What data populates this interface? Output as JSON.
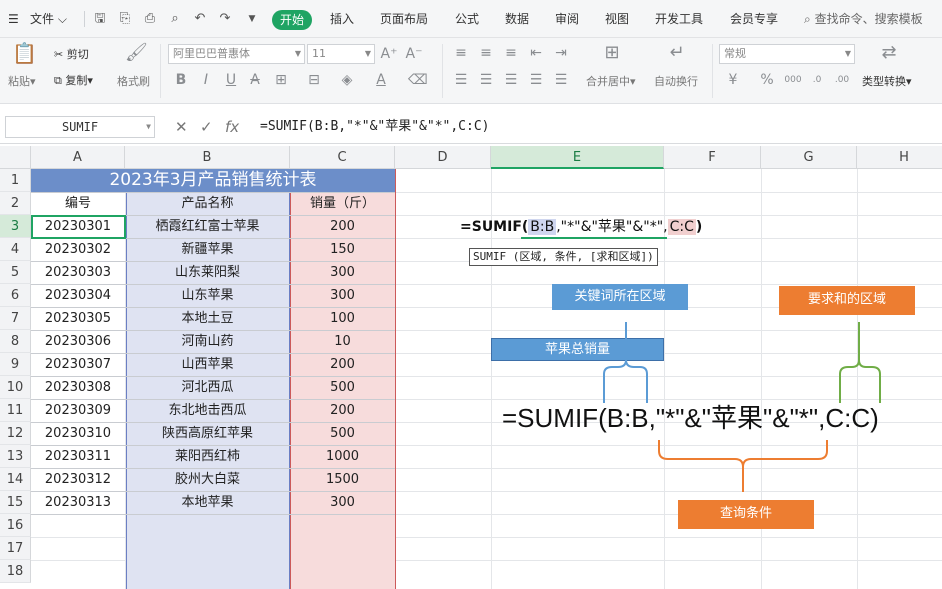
{
  "menu": {
    "file": "文件",
    "tabs": [
      "开始",
      "插入",
      "页面布局",
      "公式",
      "数据",
      "审阅",
      "视图",
      "开发工具",
      "会员专享"
    ],
    "search": "查找命令、搜索模板"
  },
  "ribbon": {
    "paste": "粘贴",
    "cut": "剪切",
    "copy": "复制",
    "format_painter": "格式刷",
    "font_name": "阿里巴巴普惠体",
    "font_size": "11",
    "merge": "合并居中",
    "wrap": "自动换行",
    "number_format": "常规",
    "type_convert": "类型转换"
  },
  "formula_bar": {
    "name_box": "SUMIF",
    "formula": "=SUMIF(B:B,\"*\"&\"苹果\"&\"*\",C:C)"
  },
  "columns": [
    "A",
    "B",
    "C",
    "D",
    "E",
    "F",
    "G",
    "H"
  ],
  "rows": [
    "1",
    "2",
    "3",
    "4",
    "5",
    "6",
    "7",
    "8",
    "9",
    "10",
    "11",
    "12",
    "13",
    "14",
    "15",
    "16",
    "17",
    "18"
  ],
  "table": {
    "title": "2023年3月产品销售统计表",
    "headers": [
      "编号",
      "产品名称",
      "销量（斤）"
    ],
    "records": [
      {
        "id": "20230301",
        "name": "栖霞红红富士苹果",
        "qty": "200"
      },
      {
        "id": "20230302",
        "name": "新疆苹果",
        "qty": "150"
      },
      {
        "id": "20230303",
        "name": "山东莱阳梨",
        "qty": "300"
      },
      {
        "id": "20230304",
        "name": "山东苹果",
        "qty": "300"
      },
      {
        "id": "20230305",
        "name": "本地土豆",
        "qty": "100"
      },
      {
        "id": "20230306",
        "name": "河南山药",
        "qty": "10"
      },
      {
        "id": "20230307",
        "name": "山西苹果",
        "qty": "200"
      },
      {
        "id": "20230308",
        "name": "河北西瓜",
        "qty": "500"
      },
      {
        "id": "20230309",
        "name": "东北地击西瓜",
        "qty": "200"
      },
      {
        "id": "20230310",
        "name": "陕西高原红苹果",
        "qty": "500"
      },
      {
        "id": "20230311",
        "name": "莱阳西红柿",
        "qty": "1000"
      },
      {
        "id": "20230312",
        "name": "胶州大白菜",
        "qty": "1500"
      },
      {
        "id": "20230313",
        "name": "本地苹果",
        "qty": "300"
      }
    ]
  },
  "annotations": {
    "apple_total": "苹果总销量",
    "edit_prefix": "=SUMIF(",
    "edit_ref_b": "B:B",
    "edit_criteria": ",\"*\"&\"苹果\"&\"*\",",
    "edit_ref_c": "C:C",
    "edit_suffix": ")",
    "tooltip": "SUMIF (区域, 条件, [求和区域])",
    "keyword_area": "关键词所在区域",
    "sum_area": "要求和的区域",
    "big_formula": "=SUMIF(B:B,\"*\"&\"苹果\"&\"*\",C:C)",
    "query_condition": "查询条件"
  },
  "colors": {
    "accent_green": "#1fa463",
    "title_blue": "#6c8ec9",
    "col_b_fill": "#dfe3f2",
    "col_c_fill": "#f7dcdc",
    "box_blue": "#5b9bd5",
    "box_orange": "#ed7d31",
    "brace_blue": "#5b9bd5",
    "brace_green": "#70ad47",
    "brace_orange": "#ed7d31"
  }
}
